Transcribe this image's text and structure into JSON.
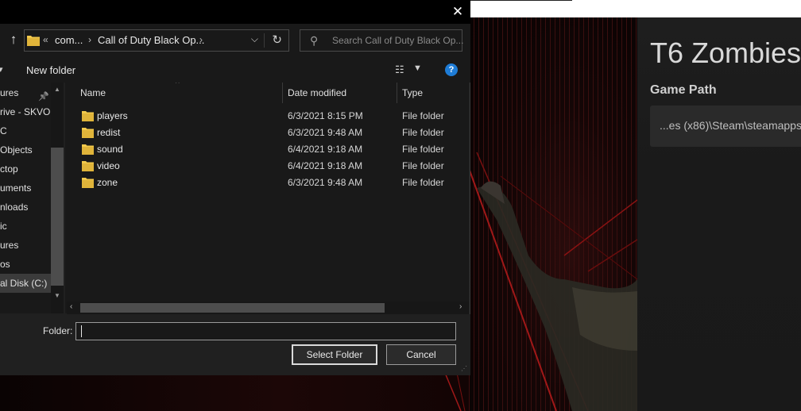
{
  "dialog": {
    "close_glyph": "✕",
    "address": {
      "prefix": "«",
      "segments": [
        "com...",
        "Call of Duty Black Op..."
      ],
      "separator": "›"
    },
    "search_placeholder": "Search Call of Duty Black Op...",
    "toolbar": {
      "new_folder": "New folder"
    },
    "nav_items": [
      {
        "label": "ures",
        "pinned": true
      },
      {
        "label": "rive - SKVOB",
        "pinned": false
      },
      {
        "label": "C",
        "pinned": false
      },
      {
        "label": "Objects",
        "pinned": false
      },
      {
        "label": "ctop",
        "pinned": false
      },
      {
        "label": "uments",
        "pinned": false
      },
      {
        "label": "nloads",
        "pinned": false
      },
      {
        "label": "ic",
        "pinned": false
      },
      {
        "label": "ures",
        "pinned": false
      },
      {
        "label": "os",
        "pinned": false
      },
      {
        "label": "al Disk (C:)",
        "pinned": false,
        "selected": true
      }
    ],
    "columns": {
      "name": "Name",
      "date": "Date modified",
      "type": "Type"
    },
    "files": [
      {
        "name": "players",
        "date": "6/3/2021 8:15 PM",
        "type": "File folder"
      },
      {
        "name": "redist",
        "date": "6/3/2021 9:48 AM",
        "type": "File folder"
      },
      {
        "name": "sound",
        "date": "6/4/2021 9:18 AM",
        "type": "File folder"
      },
      {
        "name": "video",
        "date": "6/4/2021 9:18 AM",
        "type": "File folder"
      },
      {
        "name": "zone",
        "date": "6/3/2021 9:48 AM",
        "type": "File folder"
      }
    ],
    "footer": {
      "folder_label": "Folder:",
      "folder_value": "",
      "select_button": "Select Folder",
      "cancel_button": "Cancel"
    }
  },
  "launcher": {
    "title": "T6 Zombies",
    "game_path_label": "Game Path",
    "game_path_value": "...es (x86)\\Steam\\steamapps"
  },
  "colors": {
    "folder_yellow": "#f2c94c",
    "accent_blue": "#1e7cd6"
  }
}
